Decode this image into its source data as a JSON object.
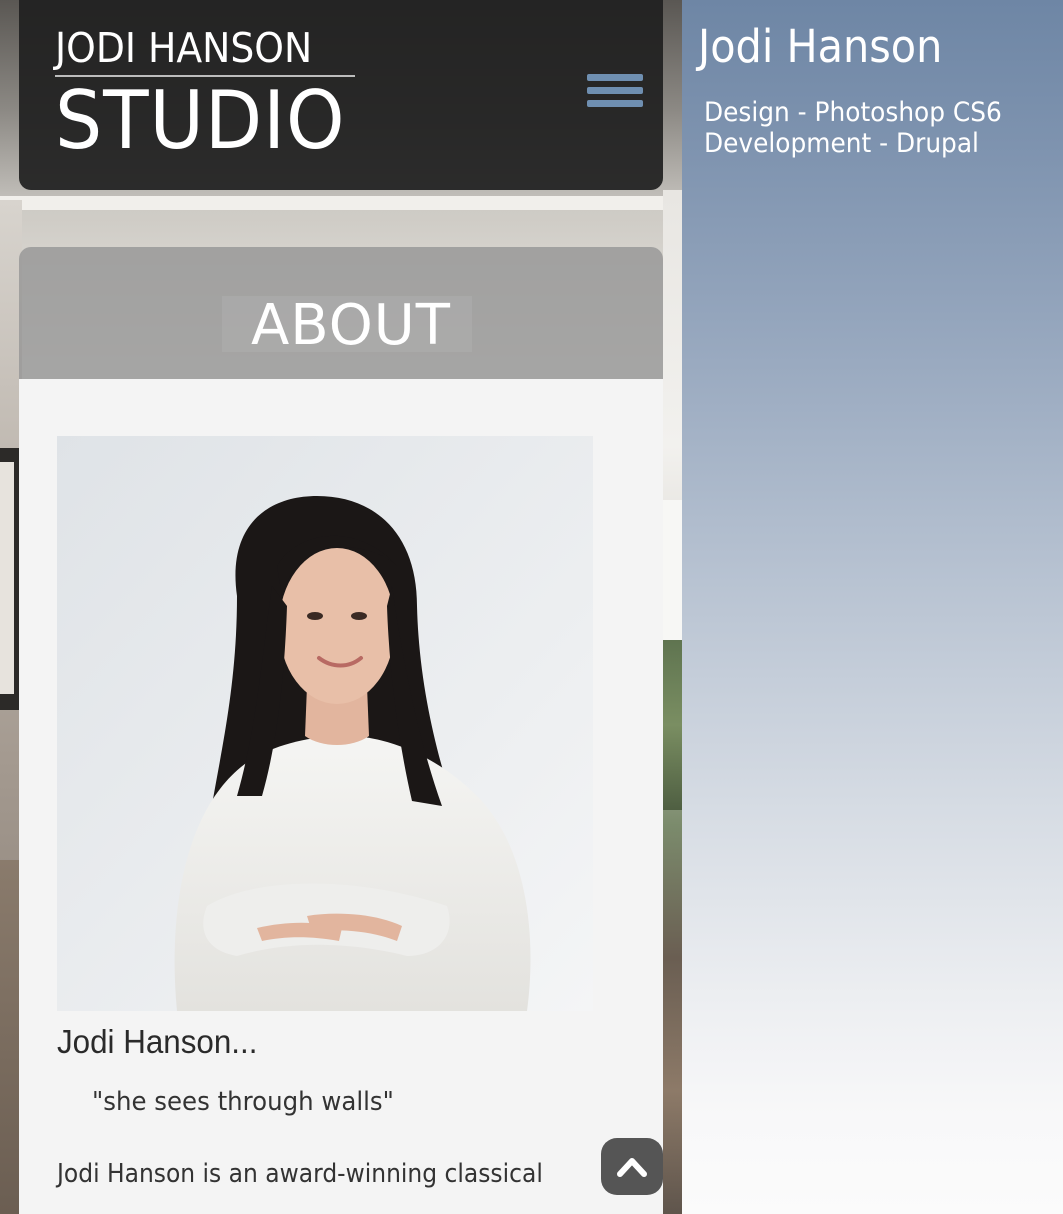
{
  "header": {
    "logo_top": "JODI HANSON",
    "logo_bottom": "STUDIO",
    "menu_icon": "hamburger-menu-icon"
  },
  "about": {
    "heading": "ABOUT",
    "name": "Jodi Hanson...",
    "quote": "\"she sees through walls\"",
    "bio_start": "Jodi Hanson is an award-winning classical"
  },
  "scroll_top": {
    "icon": "chevron-up-icon"
  },
  "side_panel": {
    "title": "Jodi Hanson",
    "lines": [
      "Design - Photoshop CS6",
      "Development - Drupal"
    ]
  },
  "colors": {
    "header_bg": "#202020",
    "menu_icon": "#6f8fb1",
    "panel_top": "#6e86a5",
    "panel_bottom": "#fbfbfb",
    "card_bg": "#f4f4f4",
    "scroll_button": "#555555"
  }
}
